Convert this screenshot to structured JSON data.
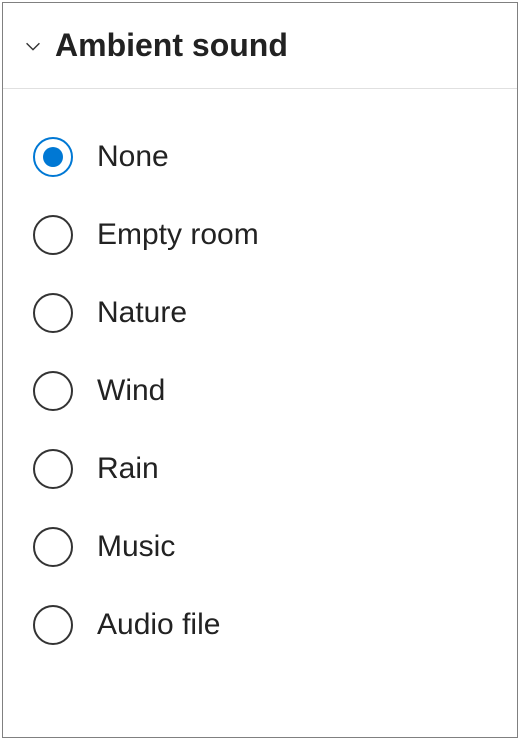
{
  "section": {
    "title": "Ambient sound",
    "expanded": true
  },
  "options": [
    {
      "id": "none",
      "label": "None",
      "selected": true
    },
    {
      "id": "empty-room",
      "label": "Empty room",
      "selected": false
    },
    {
      "id": "nature",
      "label": "Nature",
      "selected": false
    },
    {
      "id": "wind",
      "label": "Wind",
      "selected": false
    },
    {
      "id": "rain",
      "label": "Rain",
      "selected": false
    },
    {
      "id": "music",
      "label": "Music",
      "selected": false
    },
    {
      "id": "audio-file",
      "label": "Audio file",
      "selected": false
    }
  ],
  "colors": {
    "accent": "#0078d4",
    "border": "#808080",
    "divider": "#e0e0e0",
    "text": "#222"
  }
}
